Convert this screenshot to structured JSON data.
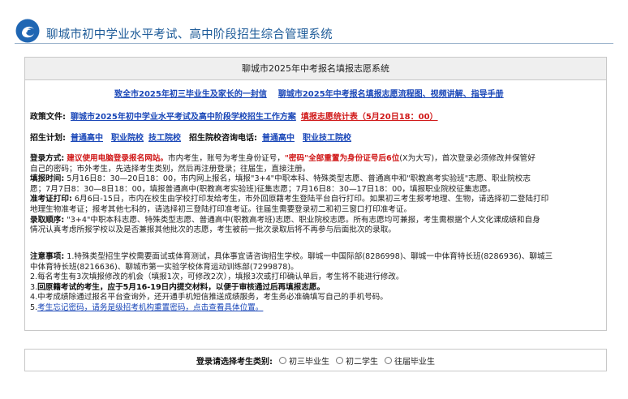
{
  "header": {
    "title": "聊城市初中学业水平考试、高中阶段招生综合管理系统",
    "logo_icon": "swirl-logo-icon",
    "brand_color": "#1f5c99"
  },
  "panel": {
    "title": "聊城市2025年中考报名填报志愿系统",
    "top_links": {
      "letter": "致全市2025年初三毕业生及家长的一封信",
      "guide": "聊城市2025年中考报名填报志愿流程图、视频讲解、指导手册"
    },
    "policy": {
      "label": "政策文件:",
      "doc_link": "聊城市2025年初中学业水平考试及高中阶段学校招生工作方案",
      "schedule_link": "填报志愿统计表（5月20日18：00）"
    },
    "plans": {
      "label": "招生计划:",
      "link1": "普通高中",
      "link2": "职业院校",
      "link3": "技工院校",
      "phone_label": "招生院校咨询电话:",
      "phone_link1": "普通高中",
      "phone_link2": "职业技工院校"
    },
    "info": {
      "login_label": "登录方式:",
      "login_red1": "建议使用电脑登录报名网站。",
      "login_t1": "市内考生，账号为考生身份证号，",
      "login_red2": "\"密码\"全部重置为身份证号后6位",
      "login_t2": "(X为大写)，首次登录必须修改并保管好",
      "login_line2": "自己的密码；市外考生，先选择考生类别，然后再注册登录；往届生，直接注册。",
      "fill_label": "填报时间:",
      "fill_t1": "5月16日8：30—20日18：00，市内网上报名，填报\"3+4\"中职本科、特殊类型志愿、普通高中和\"职教高考实验班\"志愿、职业院校志",
      "fill_line2": "愿；7月7日8：30—8日18：00，填报普通高中(职教高考实验班)征集志愿；7月16日8：30—17日18：00，填报职业院校征集志愿。",
      "print_label": "准考证打印:",
      "print_t1": "6月6日-15日，市内在校生由学校打印发给考生，市外回原籍考生登陆平台自行打印。如果初三考生报考地理、生物，请选择初二登陆打印",
      "print_line2": "地理生物准考证；报考其他七科的，请选择初三登陆打印准考证。往届生需要登录初二和初三窗口打印准考证。",
      "admit_label": "录取顺序:",
      "admit_t1": "\"3+4\"中职本科志愿、特殊类型志愿、普通高中(职教高考班)志愿、职业院校志愿。所有志愿均可兼报，考生需根据个人文化课成绩和自身",
      "admit_line2": "情况认真考虑所报学校以及是否兼报其他批次的志愿，考生被前一批次录取后将不再参与后面批次的录取。"
    },
    "notes": {
      "label": "注意事项:",
      "n1_a": "1.特殊类型招生学校需要面试或体育测试，具体事宜请咨询招生学校。聊城一中国际部(8286998)、聊城一中体育特长班(8286936)、聊城三",
      "n1_b": "中体育特长班(8216636)、聊城市第一实验学校体育运动训练部(7299878)。",
      "n2": "2.每名考生有3次填报修改的机会（填报1次，可修改2次），填报3次或打印确认单后，考生将不能进行修改。",
      "n3_prefix": "3.",
      "n3_bold": "回原籍考试的考生，应于5月16-19日内提交材料，以便于审核通过后再填报志愿。",
      "n4": "4.中考成绩除通过报名平台查询外，还开通手机短信推送成绩服务，考生务必准确填写自己的手机号码。",
      "n5_prefix": "5.",
      "n5_link": "考生忘记密码，请务是级招考机构重置密码，点击查看具体位置。"
    }
  },
  "selector": {
    "label": "登录请选择考生类别:",
    "options": [
      "初三毕业生",
      "初二学生",
      "往届毕业生"
    ]
  }
}
